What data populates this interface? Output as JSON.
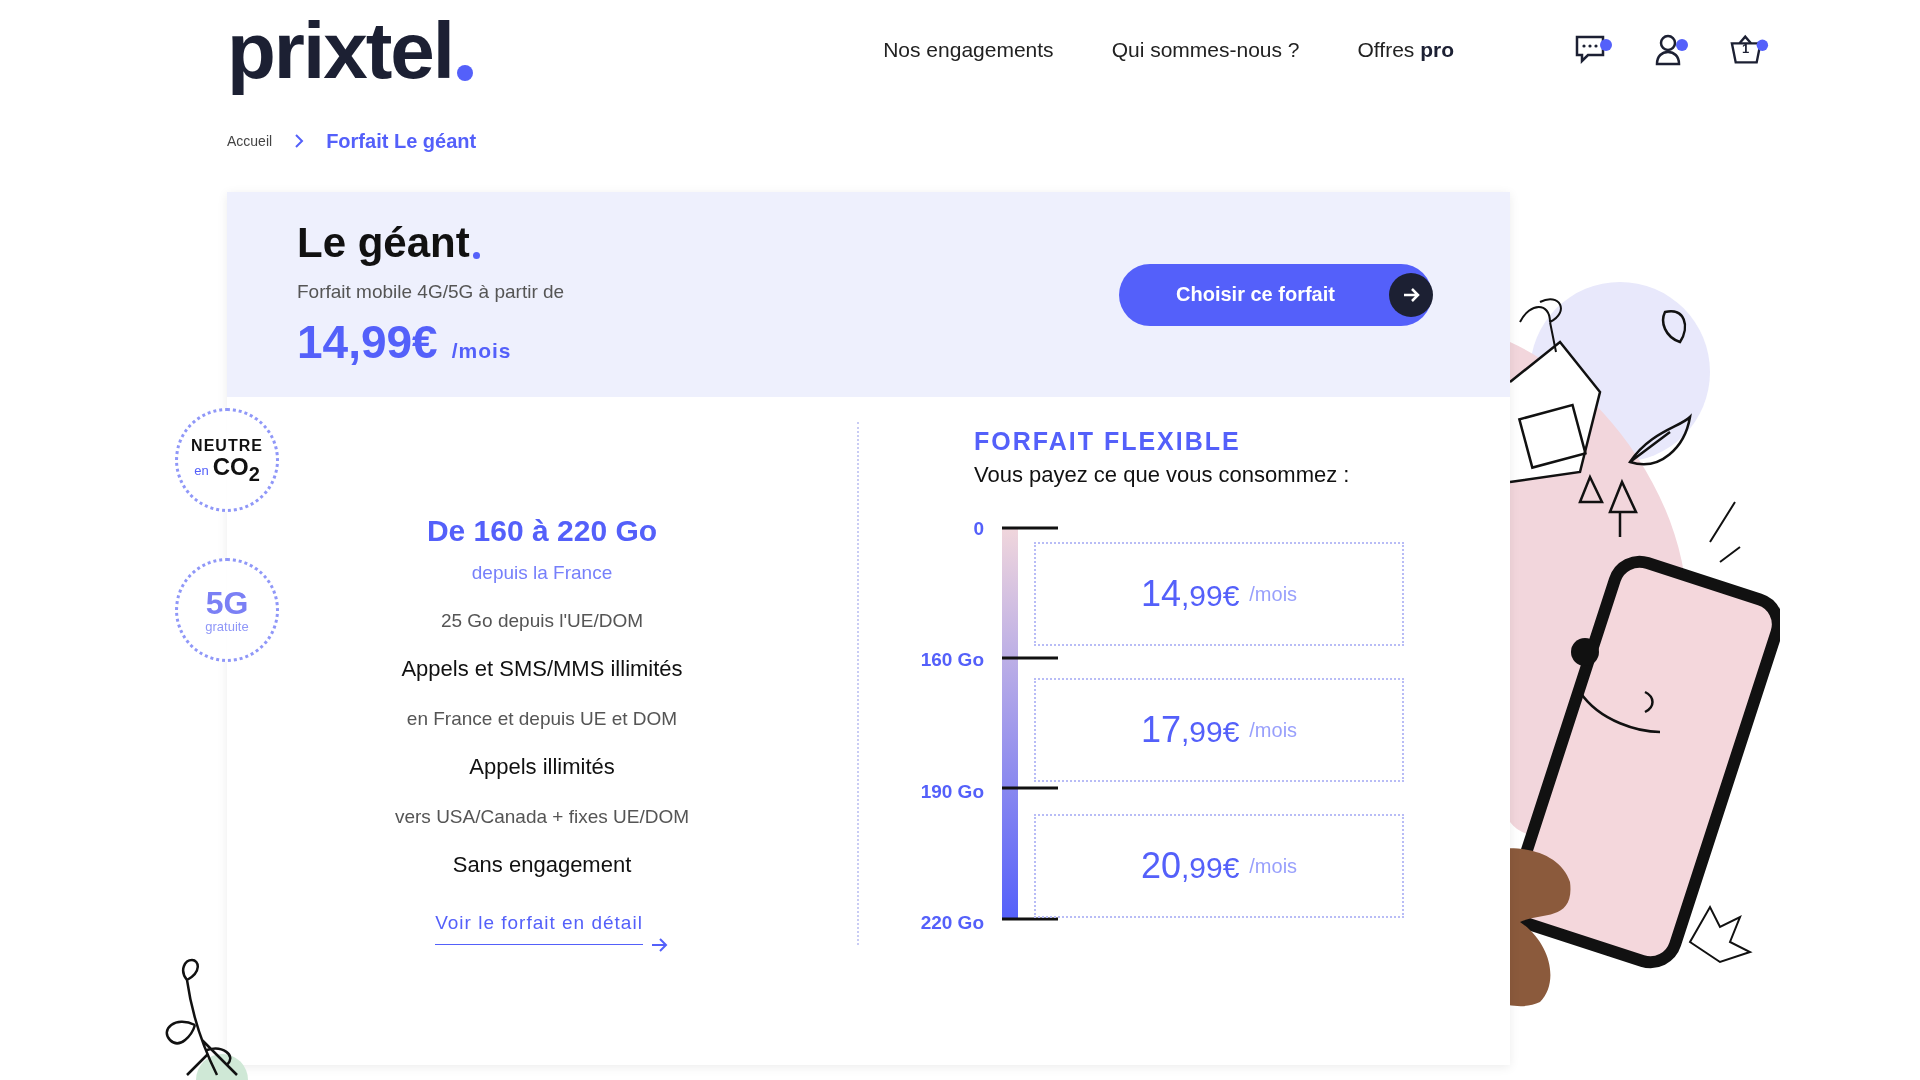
{
  "header": {
    "logo": "prixtel",
    "nav": [
      {
        "label": "Nos engagements"
      },
      {
        "label": "Qui sommes-nous ?"
      },
      {
        "label": "Offres **pro**"
      }
    ],
    "cart_count": "1"
  },
  "breadcrumb": [
    {
      "label": "Accueil",
      "current": false
    },
    {
      "label": "Forfait Le géant",
      "current": true
    }
  ],
  "offer": {
    "title": "Le géant",
    "subtitle": "Forfait mobile 4G/5G à partir de",
    "price": "14,99€",
    "period": "/mois",
    "cta": "Choisir ce forfait"
  },
  "badges": [
    {
      "kind": "co2",
      "top": "NEUTRE",
      "small": "en",
      "main": "CO$_{2}$"
    },
    {
      "kind": "fiveg",
      "main": "5G",
      "small": "gratuite"
    }
  ],
  "features": [
    {
      "kind": "headline",
      "text": "De 160 à 220 Go"
    },
    {
      "kind": "accent",
      "text": "depuis la France"
    },
    {
      "kind": "note",
      "text": "25 Go depuis l'UE/DOM"
    },
    {
      "kind": "title",
      "text": "Appels et SMS/MMS illimités"
    },
    {
      "kind": "note",
      "text": "en France et depuis UE et DOM"
    },
    {
      "kind": "title",
      "text": "Appels illimités"
    },
    {
      "kind": "note",
      "text": "vers USA/Canada + fixes UE/DOM"
    },
    {
      "kind": "title",
      "text": "Sans engagement"
    }
  ],
  "detail_link": "Voir le forfait en détail",
  "flexible": {
    "title": "FORFAIT FLEXIBLE",
    "subtitle": "Vous payez ce que vous consommez :",
    "scale": [
      "0",
      "160 Go",
      "190 Go",
      "220 Go"
    ],
    "tiers": [
      {
        "amount": "14",
        "cents": ",99€",
        "period": "/mois"
      },
      {
        "amount": "17",
        "cents": ",99€",
        "period": "/mois"
      },
      {
        "amount": "20",
        "cents": ",99€",
        "period": "/mois"
      }
    ]
  }
}
